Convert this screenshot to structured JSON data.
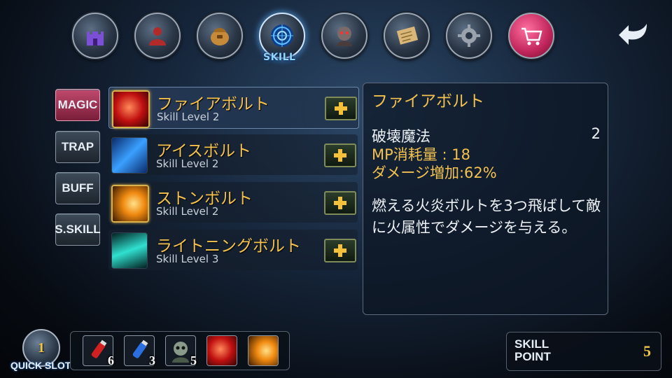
{
  "top_menu": {
    "items": [
      {
        "icon": "castle-icon"
      },
      {
        "icon": "character-icon"
      },
      {
        "icon": "bag-icon"
      },
      {
        "icon": "skill-icon",
        "label": "SKILL",
        "active": true
      },
      {
        "icon": "pet-icon"
      },
      {
        "icon": "quest-scroll-icon"
      },
      {
        "icon": "gear-icon"
      },
      {
        "icon": "shop-cart-icon"
      }
    ],
    "back_icon": "back-arrow-icon"
  },
  "categories": [
    {
      "label": "MAGIC",
      "active": true
    },
    {
      "label": "TRAP"
    },
    {
      "label": "BUFF"
    },
    {
      "label": "S.SKILL"
    }
  ],
  "skills": [
    {
      "name": "ファイアボルト",
      "level": "Skill Level 2",
      "icon": "fire-bolt-icon",
      "selected": true
    },
    {
      "name": "アイスボルト",
      "level": "Skill Level 2",
      "icon": "ice-bolt-icon"
    },
    {
      "name": "ストンボルト",
      "level": "Skill Level 2",
      "icon": "stone-bolt-icon"
    },
    {
      "name": "ライトニングボルト",
      "level": "Skill Level 3",
      "icon": "lightning-bolt-icon"
    }
  ],
  "detail": {
    "title": "ファイアボルト",
    "type": "破壊魔法",
    "level": "2",
    "mp_cost": "MP消耗量 : 18",
    "damage": "ダメージ増加:62%",
    "description": "燃える火炎ボルトを3つ飛ばして敵に火属性でダメージを与える。"
  },
  "quickslot": {
    "label": "QUICK SLOT",
    "page": "1",
    "slots": [
      {
        "icon": "red-potion-icon",
        "count": "6"
      },
      {
        "icon": "blue-potion-icon",
        "count": "3"
      },
      {
        "icon": "skull-summon-icon",
        "count": "5"
      },
      {
        "icon": "fire-bolt-icon",
        "count": ""
      },
      {
        "icon": "stone-bolt-icon",
        "count": ""
      }
    ]
  },
  "skill_point": {
    "label": "SKILL POINT",
    "value": "5"
  },
  "colors": {
    "accent_gold": "#f3c14e",
    "active_tab": "#c04a6e",
    "skill_label": "#8fd4ff"
  }
}
